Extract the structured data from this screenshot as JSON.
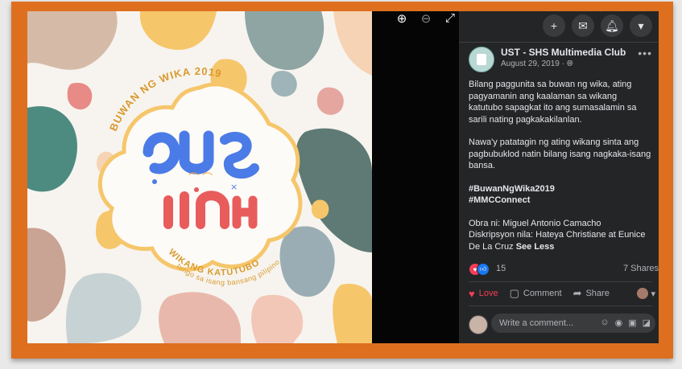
{
  "page": {
    "name": "UST - SHS Multimedia Club",
    "date": "August 29, 2019 · ",
    "globe_icon": "globe-icon"
  },
  "photo": {
    "top_text": "BUWAN NG WIKA 2019",
    "bottom_text_1": "WIKANG KATUTUBO",
    "bottom_text_2": "tungo sa isang bansang pilipino"
  },
  "post": {
    "paragraph1": "Bilang paggunita sa buwan ng wika, ating pagyamanin ang kaalaman sa wikang katutubo sapagkat ito ang sumasalamin sa sarili nating pagkakakilanlan.",
    "paragraph2": "Nawa'y patatagin ng ating wikang sinta ang pagbubuklod natin bilang isang nagkaka-isang bansa.",
    "hashtags": [
      "#BuwanNgWika2019",
      "#MMCConnect"
    ],
    "credits1": "Obra ni: Miguel Antonio Camacho",
    "credits2": "Diskripsyon nila: Hateya Christiane at Eunice De La Cruz ",
    "see_less": "See Less"
  },
  "reactions": {
    "count": "15",
    "shares": "7 Shares"
  },
  "actions": {
    "love": "Love",
    "comment": "Comment",
    "share": "Share"
  },
  "comment_box": {
    "placeholder": "Write a comment..."
  },
  "colors": {
    "frame": "#de6f1e",
    "panel": "#242526",
    "love": "#f33e58",
    "like": "#1877f2"
  }
}
